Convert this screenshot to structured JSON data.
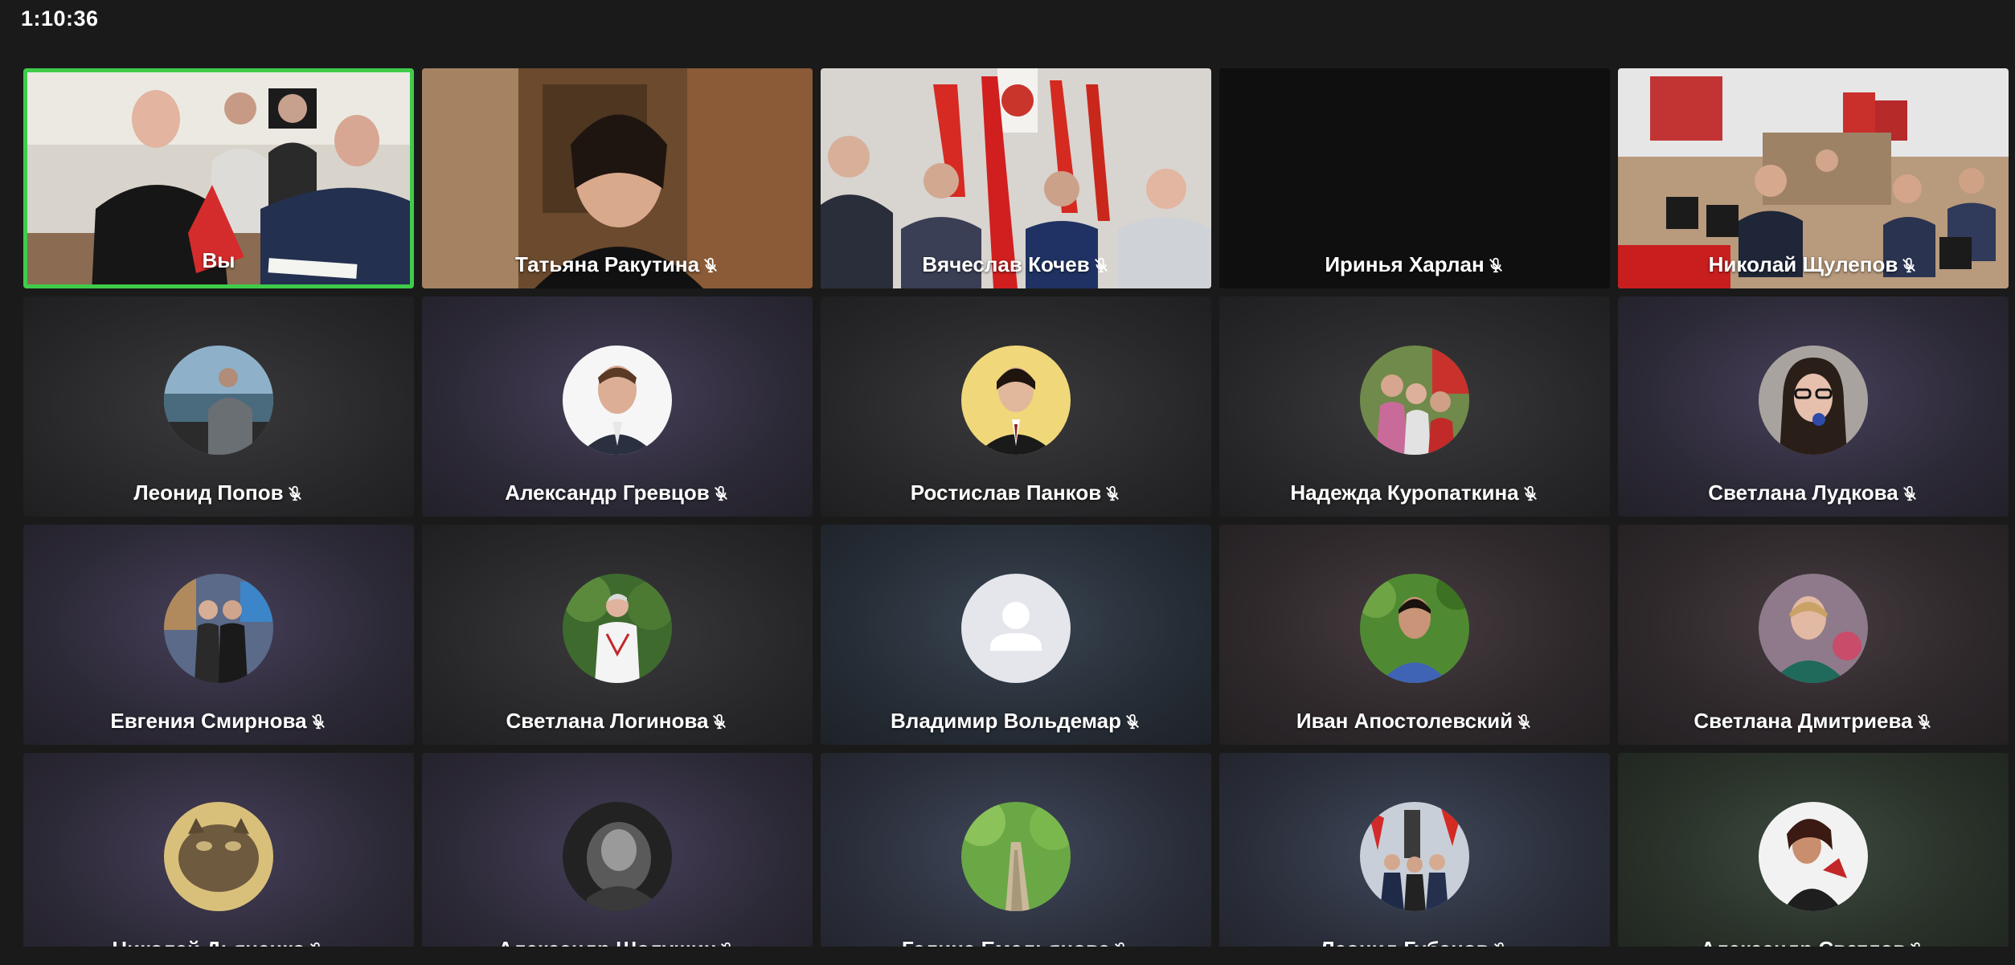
{
  "meeting": {
    "elapsed_time": "1:10:36"
  },
  "participants": [
    {
      "name": "Вы",
      "muted": false,
      "video": true,
      "self": true
    },
    {
      "name": "Татьяна Ракутина",
      "muted": true,
      "video": true
    },
    {
      "name": "Вячеслав Кочев",
      "muted": true,
      "video": true
    },
    {
      "name": "Иринья Харлан",
      "muted": true,
      "video": false,
      "blank": true
    },
    {
      "name": "Николай Щулепов",
      "muted": true,
      "video": true
    },
    {
      "name": "Леонид Попов",
      "muted": true,
      "video": false
    },
    {
      "name": "Александр Гревцов",
      "muted": true,
      "video": false
    },
    {
      "name": "Ростислав Панков",
      "muted": true,
      "video": false
    },
    {
      "name": "Надежда Куропаткина",
      "muted": true,
      "video": false
    },
    {
      "name": "Светлана Лудкова",
      "muted": true,
      "video": false
    },
    {
      "name": "Евгения Смирнова",
      "muted": true,
      "video": false
    },
    {
      "name": "Светлана Логинова",
      "muted": true,
      "video": false
    },
    {
      "name": "Владимир Вольдемар",
      "muted": true,
      "video": false,
      "default_avatar": true
    },
    {
      "name": "Иван Апостолевский",
      "muted": true,
      "video": false
    },
    {
      "name": "Светлана Дмитриева",
      "muted": true,
      "video": false
    },
    {
      "name": "Николай Дьяченко",
      "muted": true,
      "video": false
    },
    {
      "name": "Александр Шолушин",
      "muted": true,
      "video": false
    },
    {
      "name": "Галина Емельянова",
      "muted": true,
      "video": false
    },
    {
      "name": "Леонид Губанов",
      "muted": true,
      "video": false
    },
    {
      "name": "Александр Светлов",
      "muted": true,
      "video": false
    }
  ],
  "colors": {
    "active_speaker_border": "#3ecc4a",
    "background": "#1a1a1a"
  },
  "icons": {
    "muted": "mic-off-icon",
    "default_avatar": "person-icon"
  }
}
